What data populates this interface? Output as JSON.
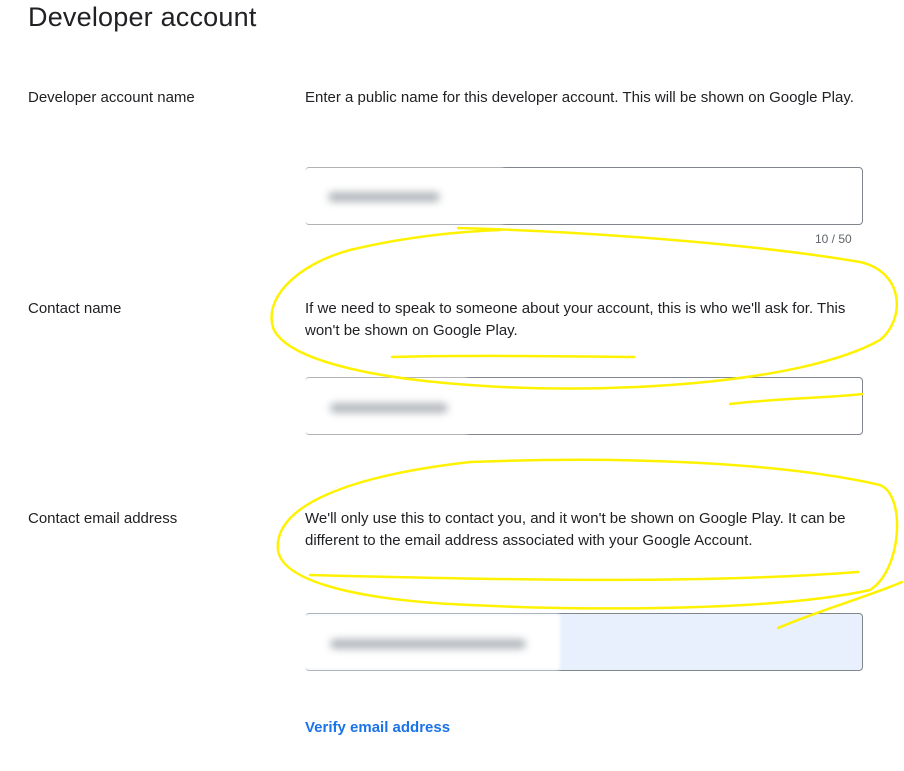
{
  "page": {
    "title": "Developer account"
  },
  "fields": {
    "account_name": {
      "label": "Developer account name",
      "description": "Enter a public name for this developer account. This will be shown on Google Play.",
      "counter": "10 / 50"
    },
    "contact_name": {
      "label": "Contact name",
      "description": "If we need to speak to someone about your account, this is who we'll ask for. This won't be shown on Google Play."
    },
    "contact_email": {
      "label": "Contact email address",
      "description": "We'll only use this to contact you, and it won't be shown on Google Play. It can be different to the email address associated with your Google Account."
    }
  },
  "actions": {
    "verify_email": "Verify email address"
  },
  "colors": {
    "link": "#1a73e8",
    "annotation": "#fff200",
    "autofill": "#e8f0fe"
  }
}
